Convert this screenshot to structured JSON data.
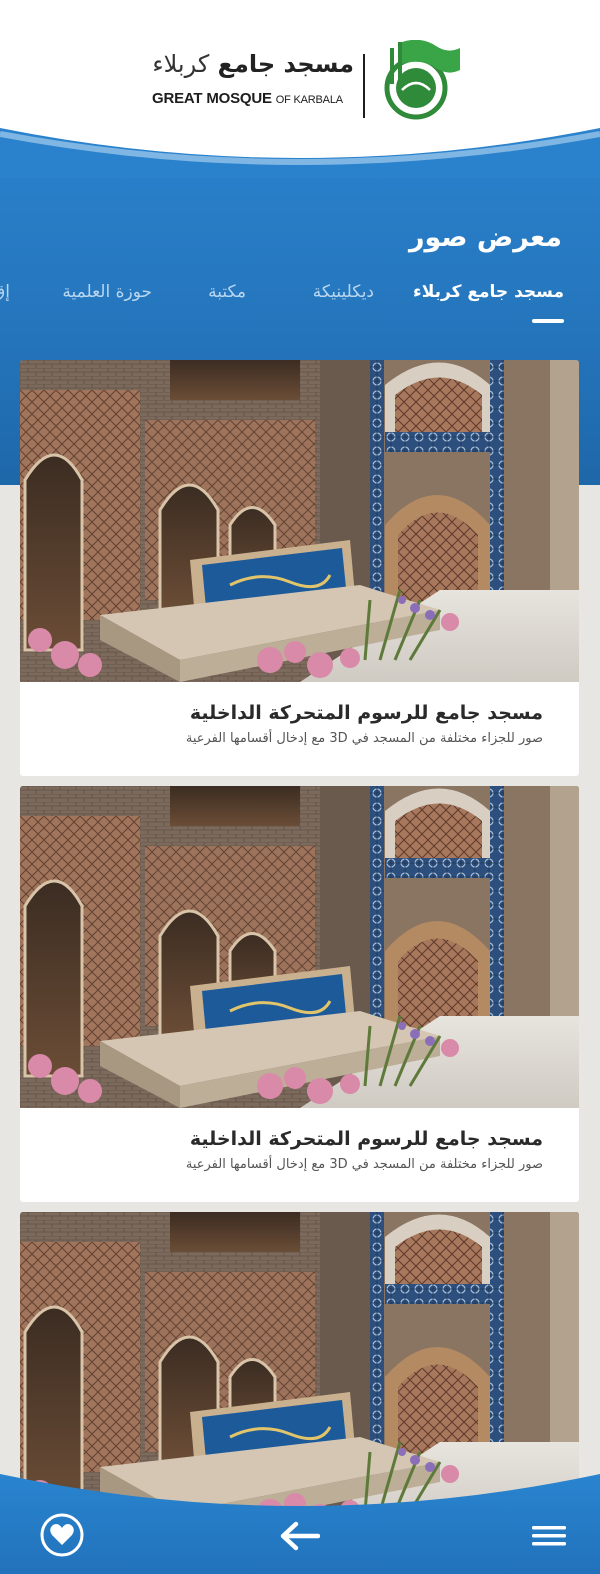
{
  "header": {
    "logo_arabic_bold": "مسجد جامع",
    "logo_arabic_light": "كربلاء",
    "logo_english_bold": "GREAT MOSQUE",
    "logo_english_small": "OF KARBALA",
    "emblem_icon": "mosque-flag-emblem-icon"
  },
  "gallery": {
    "title": "معرض صور",
    "tabs": [
      {
        "label": "مسجد جامع كربلاء",
        "active": true
      },
      {
        "label": "ديكلينيكة",
        "active": false
      },
      {
        "label": "مكتبة",
        "active": false
      },
      {
        "label": "حوزة العلمية",
        "active": false
      },
      {
        "label": "إق",
        "active": false
      }
    ]
  },
  "cards": [
    {
      "title": "مسجد جامع للرسوم المتحركة الداخلية",
      "description": "صور للجزاء مختلفة من المسجد في 3D مع إدخال أقسامها الفرعية"
    },
    {
      "title": "مسجد جامع للرسوم المتحركة الداخلية",
      "description": "صور للجزاء مختلفة من المسجد في 3D مع إدخال أقسامها الفرعية"
    },
    {
      "title": "",
      "description": ""
    }
  ],
  "bottom_nav": {
    "favorites_icon": "heart-icon",
    "back_icon": "arrow-left-icon",
    "menu_icon": "hamburger-menu-icon"
  },
  "colors": {
    "primary_blue": "#2a82cc",
    "white": "#ffffff",
    "card_text": "#2a2a2a",
    "background": "#e8e6e3"
  }
}
